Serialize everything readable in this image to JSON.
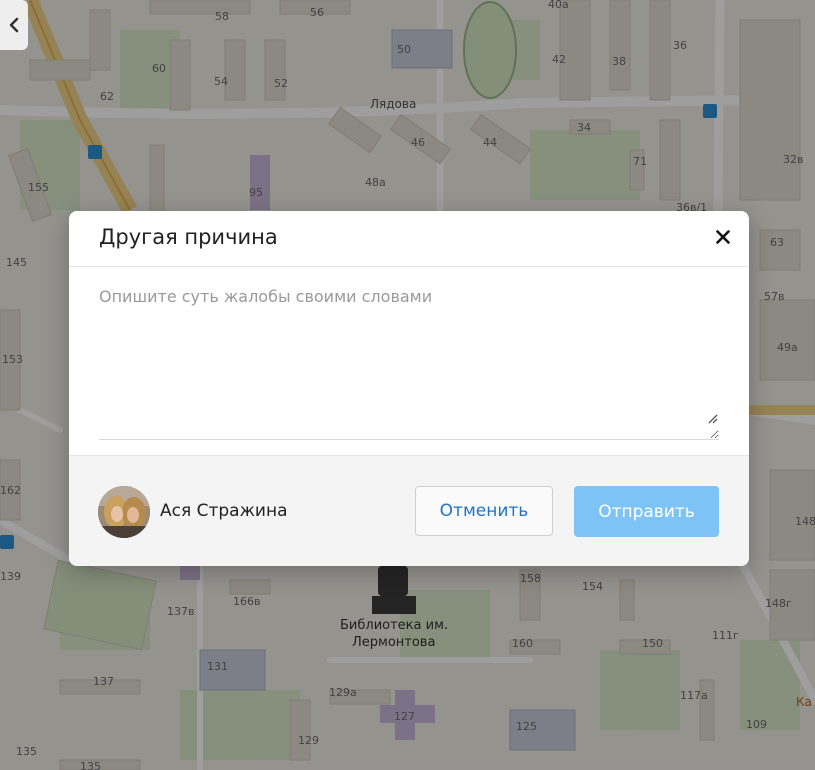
{
  "map": {
    "street_name": "Лядова",
    "library_label_line1": "Библиотека им.",
    "library_label_line2": "Лермонтова",
    "corner_label": "Ка",
    "house_numbers": [
      "58",
      "56",
      "40а",
      "36",
      "50",
      "42",
      "38",
      "60",
      "54",
      "52",
      "62",
      "34",
      "46",
      "44",
      "71",
      "32в",
      "155",
      "95",
      "48а",
      "36в/1",
      "145",
      "63",
      "57в",
      "153",
      "49а",
      "162",
      "148",
      "139",
      "158",
      "154",
      "166в",
      "137в",
      "148г",
      "160",
      "150",
      "111г",
      "131",
      "137",
      "129а",
      "117а",
      "127",
      "125",
      "109",
      "135",
      "135",
      "129"
    ]
  },
  "dialog": {
    "title": "Другая причина",
    "close_icon": "close-icon",
    "complaint_placeholder": "Опишите суть жалобы своими словами",
    "complaint_value": "",
    "user_name": "Ася Стражина",
    "cancel_label": "Отменить",
    "submit_label": "Отправить"
  },
  "colors": {
    "overlay": "rgba(0,0,0,0.38)",
    "accent_link": "#1e74c8",
    "submit_disabled": "#7ec3f5",
    "footer_bg": "#f4f4f4"
  }
}
